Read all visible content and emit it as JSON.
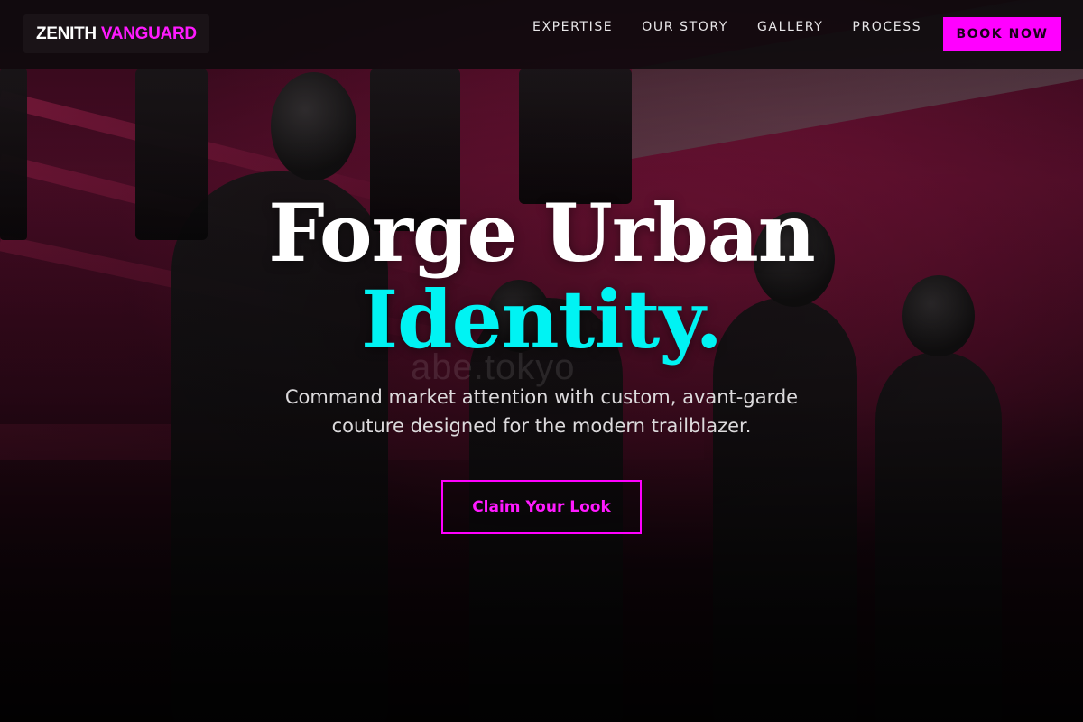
{
  "brand": {
    "name_primary": "ZENITH",
    "name_accent": "VANGUARD"
  },
  "nav": {
    "links": [
      {
        "label": "EXPERTISE"
      },
      {
        "label": "OUR STORY"
      },
      {
        "label": "GALLERY"
      },
      {
        "label": "PROCESS"
      }
    ],
    "cta_label": "BOOK NOW"
  },
  "hero": {
    "title_line1": "Forge Urban",
    "title_line2": "Identity.",
    "subtitle": "Command market attention with custom, avant-garde couture designed for the modern trailblazer.",
    "cta_label": "Claim Your Look",
    "watermark": "abe.tokyo"
  },
  "colors": {
    "accent_magenta": "#ff00ff",
    "accent_cyan": "#00f3f3",
    "nav_background": "#0c0a0c"
  },
  "icons": []
}
